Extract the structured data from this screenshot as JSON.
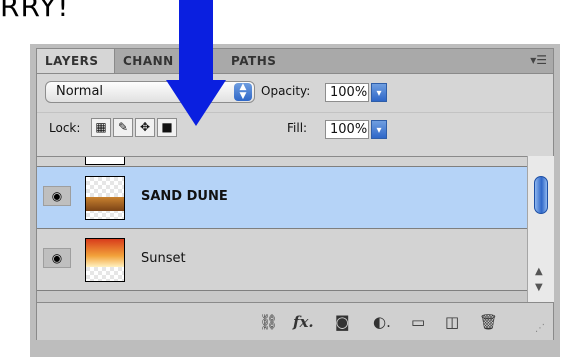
{
  "caption": "RRY!",
  "tabs": [
    "LAYERS",
    "CHANN",
    "PATHS"
  ],
  "blend_mode": "Normal",
  "opacity": {
    "label": "Opacity:",
    "value": "100%"
  },
  "lock": {
    "label": "Lock:"
  },
  "fill": {
    "label": "Fill:",
    "value": "100%"
  },
  "layers": [
    {
      "name": "SAND DUNE",
      "selected": true
    },
    {
      "name": "Sunset",
      "selected": false
    }
  ],
  "icons": {
    "panel_menu": "panel-menu-icon",
    "eye": "eye-icon",
    "lock_transparent": "lock-transparent-icon",
    "lock_image": "lock-brush-icon",
    "lock_position": "lock-move-icon",
    "lock_all": "lock-all-icon",
    "link": "link-icon",
    "fx": "fx-icon",
    "mask": "mask-icon",
    "adjust": "adjustment-icon",
    "folder": "folder-icon",
    "new_layer": "new-layer-icon",
    "trash": "trash-icon"
  },
  "colors": {
    "arrow": "#0a1fe0",
    "selected_row": "#b5d3f7"
  }
}
